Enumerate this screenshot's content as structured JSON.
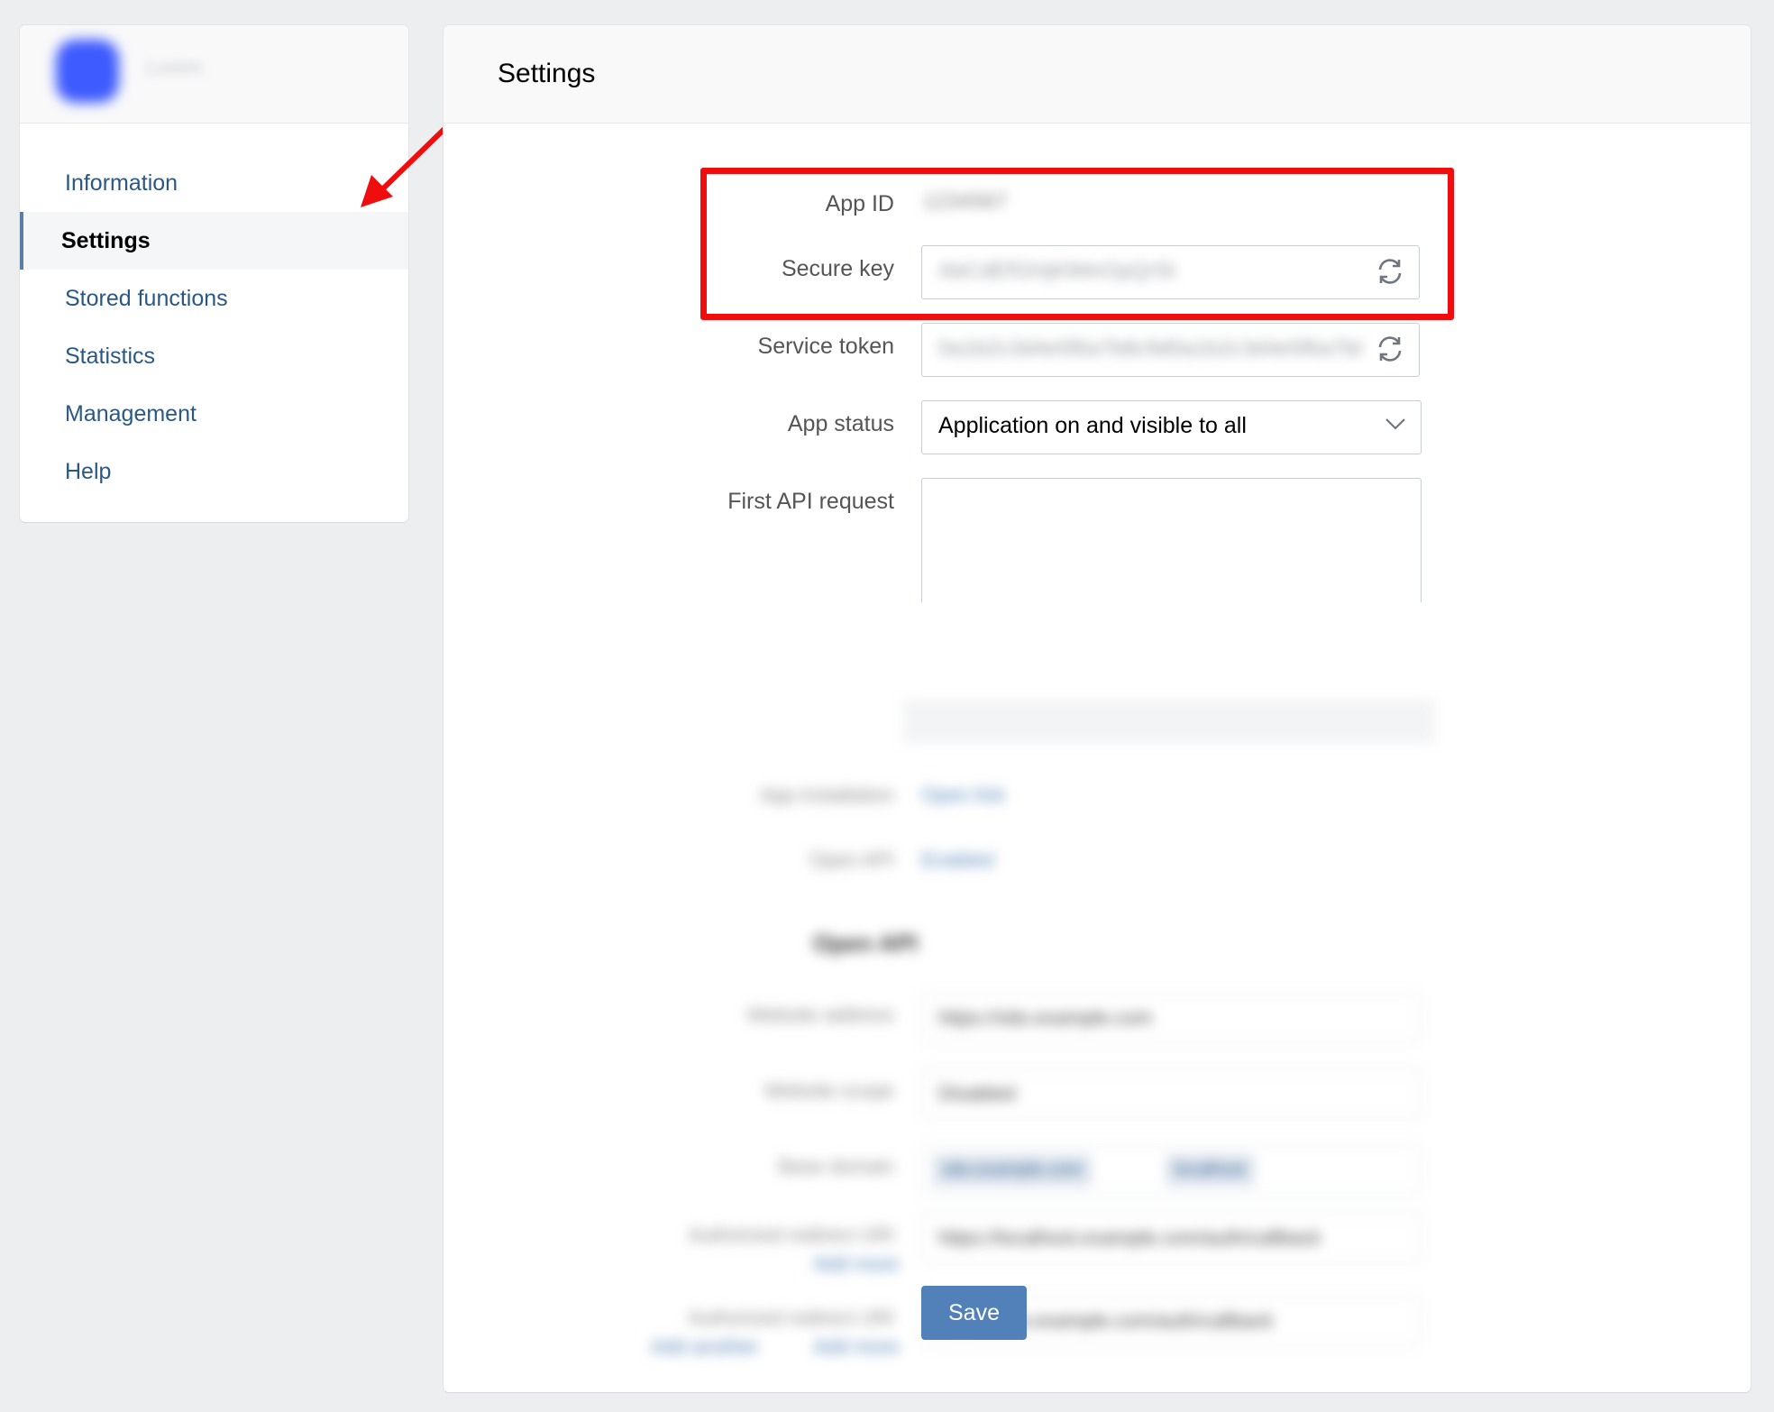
{
  "sidebar": {
    "app_name": "Lorem",
    "items": [
      {
        "label": "Information"
      },
      {
        "label": "Settings"
      },
      {
        "label": "Stored functions"
      },
      {
        "label": "Statistics"
      },
      {
        "label": "Management"
      },
      {
        "label": "Help"
      }
    ],
    "active_index": 1
  },
  "main": {
    "title": "Settings",
    "app_id": {
      "label": "App ID",
      "value": "1234567"
    },
    "secure_key": {
      "label": "Secure key",
      "value": "AbCdEfGhIjKlMnOpQrSt"
    },
    "service_token": {
      "label": "Service token",
      "value": "0a1b2c3d4e5f6a7b8c9d0a1b2c3d4e5f6a7b8c9d0a1b2c3d"
    },
    "app_status": {
      "label": "App status",
      "value": "Application on and visible to all"
    },
    "first_api_request": {
      "label": "First API request",
      "value": ""
    },
    "blurred": {
      "app_installation_label": "App installation",
      "app_installation_link": "Open link",
      "open_api_label": "Open API",
      "open_api_link": "Enabled",
      "section_title": "Open API",
      "website_address_label": "Website address",
      "website_address_value": "https://site.example.com",
      "website_scope_label": "Website scope",
      "website_scope_value": "Disabled",
      "base_domain_label": "Base domain",
      "base_domain_chip_1": "site.example.com",
      "base_domain_chip_2": "localhost",
      "redirect_uri_label": "Authorized redirect URI",
      "redirect_uri_link": "Add more",
      "redirect_uri_value": "https://localhost.example.com/auth/callback",
      "redirect_uri2_label": "Authorized redirect URI",
      "redirect_uri2_link_1": "Add another",
      "redirect_uri2_link_2": "Add more",
      "redirect_uri2_value": "https://site.example.com/auth/callback"
    },
    "save_label": "Save"
  },
  "colors": {
    "accent": "#5181b8",
    "link": "#2a5885",
    "highlight": "#f00d0d",
    "background": "#edeef0"
  }
}
